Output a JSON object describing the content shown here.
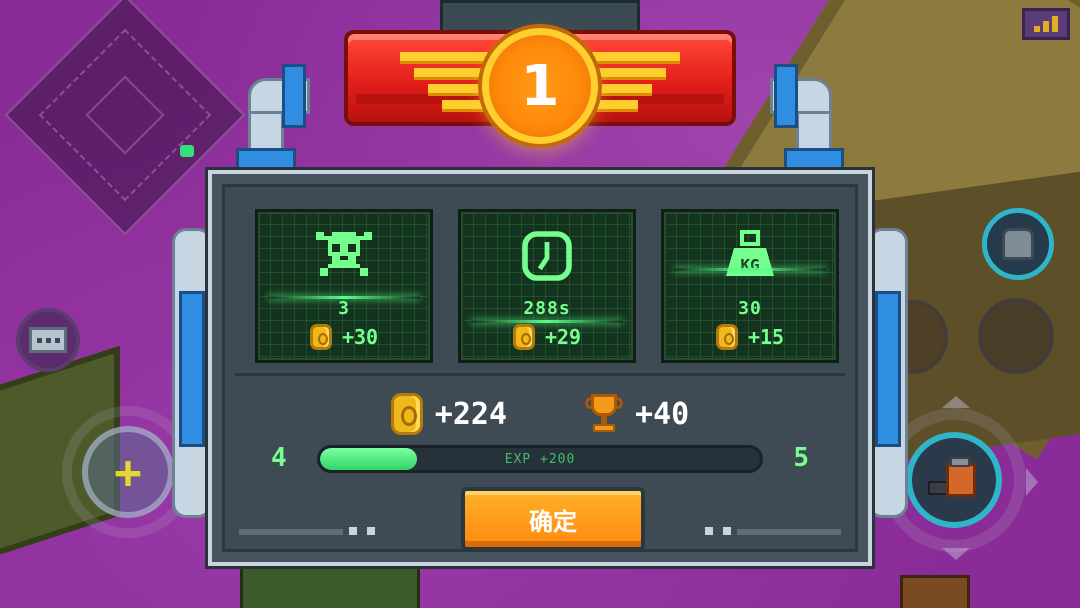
{
  "rank": "1",
  "stats": [
    {
      "icon": "skull-icon",
      "value": "3",
      "reward": "+30"
    },
    {
      "icon": "clock-icon",
      "value": "288s",
      "reward": "+29"
    },
    {
      "icon": "weight-icon",
      "icon_text": "KG",
      "value": "30",
      "reward": "+15"
    }
  ],
  "totals": {
    "coins": "+224",
    "trophies": "+40"
  },
  "level": {
    "current": "4",
    "next": "5",
    "exp_label": "EXP +200",
    "exp_progress": 0.22
  },
  "confirm_label": "确定",
  "colors": {
    "panel": "#46525c",
    "screen_green": "#74ff8f",
    "coin": "#f0b81a",
    "banner_red": "#e41e1a",
    "medal_orange": "#ff8a0a",
    "button_orange": "#ff8a0f"
  }
}
